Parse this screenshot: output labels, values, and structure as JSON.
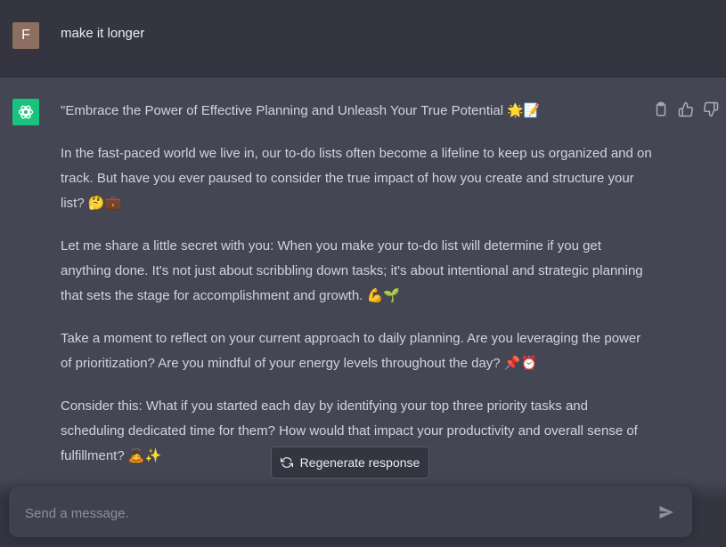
{
  "user_message": {
    "avatar_letter": "F",
    "text": "make it longer"
  },
  "assistant_message": {
    "paragraphs": [
      "\"Embrace the Power of Effective Planning and Unleash Your True Potential 🌟📝",
      "In the fast-paced world we live in, our to-do lists often become a lifeline to keep us organized and on track. But have you ever paused to consider the true impact of how you create and structure your list? 🤔💼",
      "Let me share a little secret with you: When you make your to-do list will determine if you get anything done. It's not just about scribbling down tasks; it's about intentional and strategic planning that sets the stage for accomplishment and growth. 💪🌱",
      "Take a moment to reflect on your current approach to daily planning. Are you leveraging the power of prioritization? Are you mindful of your energy levels throughout the day? 📌⏰",
      "Consider this: What if you started each day by identifying your top three priority tasks and scheduling dedicated time for them? How would that impact your productivity and overall sense of fulfillment? 🙇✨"
    ]
  },
  "regenerate_label": "Regenerate response",
  "composer": {
    "placeholder": "Send a message."
  },
  "colors": {
    "assistant_bg": "#444654",
    "user_bg": "#343541",
    "accent_green": "#19c37d"
  }
}
